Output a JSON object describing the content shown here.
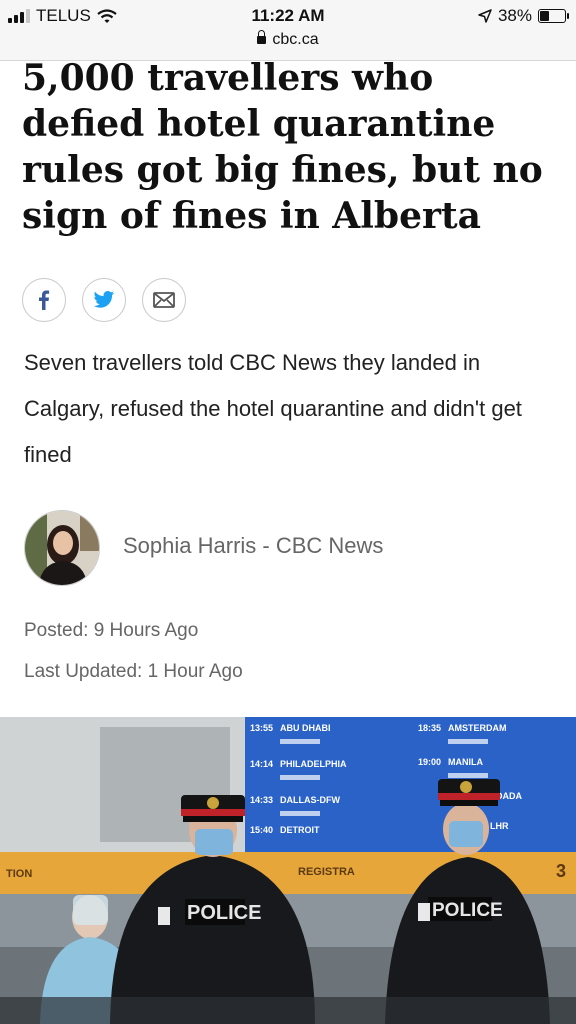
{
  "status_bar": {
    "carrier": "TELUS",
    "time": "11:22 AM",
    "url": "cbc.ca",
    "battery": "38%",
    "battery_level": 0.38
  },
  "article": {
    "headline": "5,000 travellers who defied hotel quarantine rules got big fines, but no sign of fines in Alberta",
    "deck": "Seven travellers told CBC News they landed in Calgary, refused the hotel quarantine and didn't get fined",
    "byline": "Sophia Harris - CBC News",
    "posted": "Posted: 9 Hours Ago",
    "updated": "Last Updated: 1 Hour Ago"
  },
  "share": {
    "icons": [
      "facebook-icon",
      "twitter-icon",
      "email-icon"
    ],
    "facebook_color": "#3b5998",
    "twitter_color": "#1da1f2",
    "email_color": "#555555"
  },
  "photo": {
    "board_left": [
      "ABU DHABI",
      "PHILADELPHIA",
      "DALLAS-DFW",
      "DETROIT"
    ],
    "board_left_times": [
      "13:55",
      "14:14",
      "14:33",
      "15:40"
    ],
    "board_right": [
      "AMSTERDAM",
      "MANILA",
      "LOADA",
      "LHR"
    ],
    "board_right_times": [
      "18:35",
      "19:00",
      "",
      ""
    ],
    "counter_labels": [
      "TION",
      "REGISTRA",
      "3"
    ],
    "police_label": "POLICE"
  }
}
